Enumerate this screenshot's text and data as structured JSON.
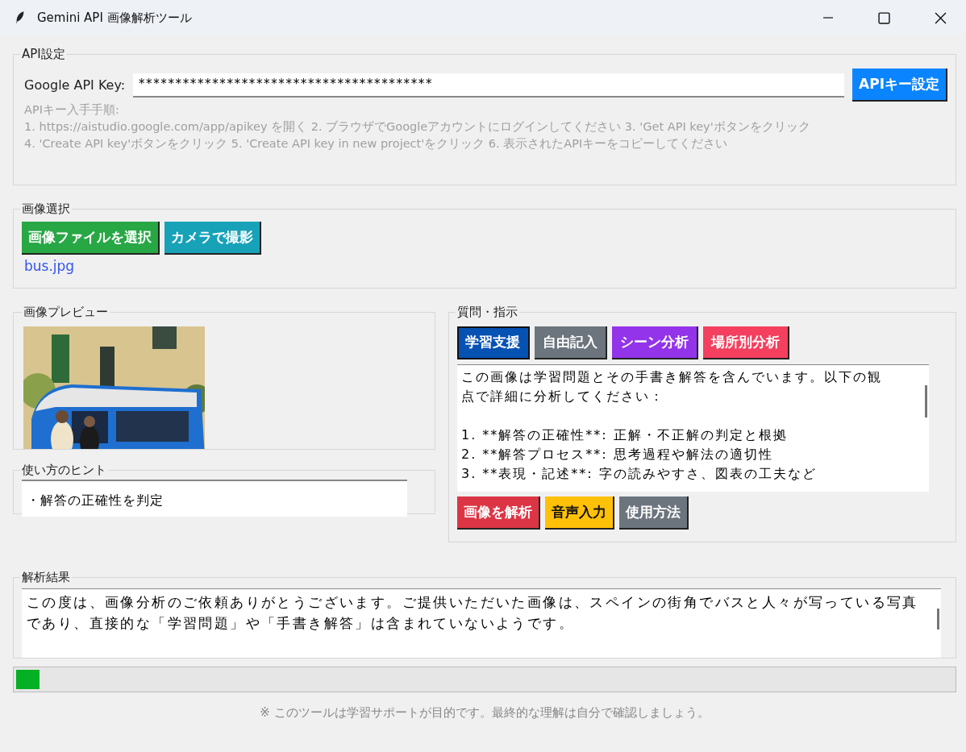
{
  "window": {
    "title": "Gemini API 画像解析ツール"
  },
  "api_settings": {
    "title": "API設定",
    "key_label": "Google API Key:",
    "key_value": "****************************************",
    "set_button": "APIキー設定",
    "instructions_heading": "APIキー入手手順:",
    "instructions": [
      "1. https://aistudio.google.com/app/apikey を開く 2. ブラウザでGoogleアカウントにログインしてください 3. 'Get API key'ボタンをクリック",
      "4. 'Create API key'ボタンをクリック 5. 'Create API key in new project'をクリック 6. 表示されたAPIキーをコピーしてください"
    ]
  },
  "image_select": {
    "title": "画像選択",
    "buttons": [
      {
        "label": "画像ファイルを選択",
        "color": "#28a745"
      },
      {
        "label": "カメラで撮影",
        "color": "#17a2b8"
      }
    ],
    "file_name": "bus.jpg"
  },
  "preview": {
    "title": "画像プレビュー"
  },
  "hints": {
    "title": "使い方のヒント",
    "lines": [
      "・解答の正確性を判定"
    ]
  },
  "prompt": {
    "title": "質問・指示",
    "tabs": [
      {
        "label": "学習支援",
        "color": "#0652b3",
        "selected": true
      },
      {
        "label": "自由記入",
        "color": "#6c757d",
        "selected": false
      },
      {
        "label": "シーン分析",
        "color": "#9333ea",
        "selected": false
      },
      {
        "label": "場所別分析",
        "color": "#f43f5e",
        "selected": false
      }
    ],
    "intro": [
      "この画像は学習問題とその手書き解答を含んでいます。以下の観",
      "点で詳細に分析してください："
    ],
    "items": [
      "1. **解答の正確性**: 正解・不正解の判定と根拠",
      "2. **解答プロセス**: 思考過程や解法の適切性",
      "3. **表現・記述**: 字の読みやすさ、図表の工夫など"
    ],
    "actions": [
      {
        "label": "画像を解析",
        "color": "#dc3545",
        "dark_text": false
      },
      {
        "label": "音声入力",
        "color": "#ffc107",
        "dark_text": true
      },
      {
        "label": "使用方法",
        "color": "#6c757d",
        "dark_text": false
      }
    ]
  },
  "result": {
    "title": "解析結果",
    "lines": [
      "この度は、画像分析のご依頼ありがとうございます。ご提供いただいた画像は、スペインの街角でバスと人々が写っている写真",
      "であり、直接的な「学習問題」や「手書き解答」は含まれていないようです。"
    ]
  },
  "progress": {
    "level": 0.025
  },
  "footer": "※ このツールは学習サポートが目的です。最終的な理解は自分で確認しましょう。"
}
